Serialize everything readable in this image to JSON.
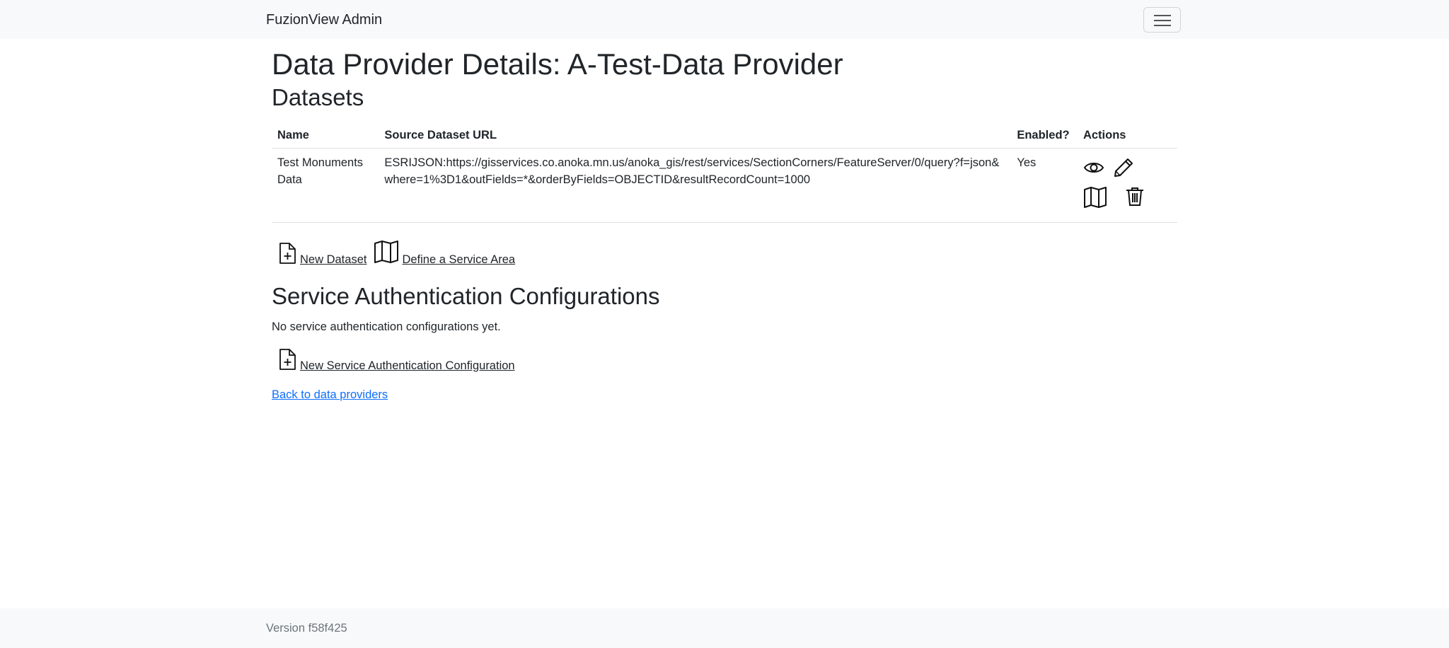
{
  "navbar": {
    "brand": "FuzionView Admin",
    "toggler_icon": "hamburger-icon"
  },
  "page": {
    "title": "Data Provider Details: A-Test-Data Provider"
  },
  "datasets": {
    "heading": "Datasets",
    "columns": {
      "name": "Name",
      "url": "Source Dataset URL",
      "enabled": "Enabled?",
      "actions": "Actions"
    },
    "rows": [
      {
        "name": "Test Monuments Data",
        "url": "ESRIJSON:https://gisservices.co.anoka.mn.us/anoka_gis/rest/services/SectionCorners/FeatureServer/0/query?f=json&where=1%3D1&outFields=*&orderByFields=OBJECTID&resultRecordCount=1000",
        "enabled": "Yes",
        "actions": [
          "eye-icon",
          "pencil-icon",
          "map-icon",
          "trash-icon"
        ]
      }
    ],
    "new_dataset_label": "New Dataset",
    "define_service_area_label": "Define a Service Area"
  },
  "service_auth": {
    "heading": "Service Authentication Configurations",
    "empty_message": "No service authentication configurations yet.",
    "new_label": "New Service Authentication Configuration"
  },
  "back_link": "Back to data providers",
  "footer": {
    "version": "Version f58f425"
  }
}
